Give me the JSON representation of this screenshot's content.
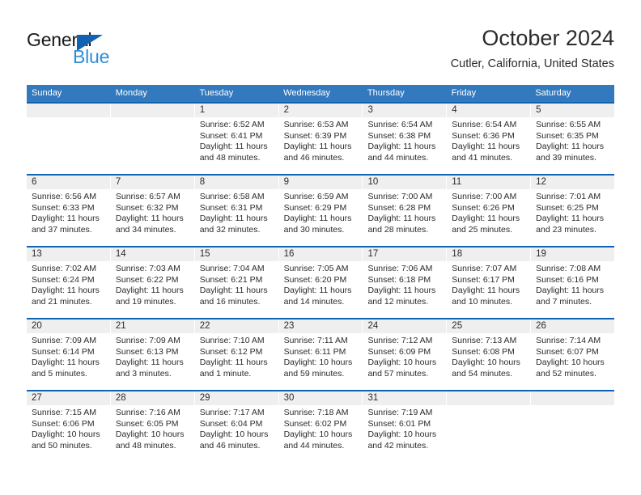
{
  "logo": {
    "word_one": "General",
    "word_two": "Blue",
    "triangle_icon": "triangle-icon",
    "brand_blue": "#2a8fd8",
    "triangle_blue": "#1262b3"
  },
  "header": {
    "title": "October 2024",
    "subtitle": "Cutler, California, United States"
  },
  "colors": {
    "header_row_bg": "#3279bd",
    "week_border": "#1262b3",
    "daynum_bg": "#efefef",
    "text": "#2b2b2b"
  },
  "weekdays": [
    "Sunday",
    "Monday",
    "Tuesday",
    "Wednesday",
    "Thursday",
    "Friday",
    "Saturday"
  ],
  "weeks": [
    [
      {
        "day": "",
        "sunrise": "",
        "sunset": "",
        "daylight_line1": "",
        "daylight_line2": "",
        "empty": true
      },
      {
        "day": "",
        "sunrise": "",
        "sunset": "",
        "daylight_line1": "",
        "daylight_line2": "",
        "empty": true
      },
      {
        "day": "1",
        "sunrise": "Sunrise: 6:52 AM",
        "sunset": "Sunset: 6:41 PM",
        "daylight_line1": "Daylight: 11 hours",
        "daylight_line2": "and 48 minutes.",
        "empty": false
      },
      {
        "day": "2",
        "sunrise": "Sunrise: 6:53 AM",
        "sunset": "Sunset: 6:39 PM",
        "daylight_line1": "Daylight: 11 hours",
        "daylight_line2": "and 46 minutes.",
        "empty": false
      },
      {
        "day": "3",
        "sunrise": "Sunrise: 6:54 AM",
        "sunset": "Sunset: 6:38 PM",
        "daylight_line1": "Daylight: 11 hours",
        "daylight_line2": "and 44 minutes.",
        "empty": false
      },
      {
        "day": "4",
        "sunrise": "Sunrise: 6:54 AM",
        "sunset": "Sunset: 6:36 PM",
        "daylight_line1": "Daylight: 11 hours",
        "daylight_line2": "and 41 minutes.",
        "empty": false
      },
      {
        "day": "5",
        "sunrise": "Sunrise: 6:55 AM",
        "sunset": "Sunset: 6:35 PM",
        "daylight_line1": "Daylight: 11 hours",
        "daylight_line2": "and 39 minutes.",
        "empty": false
      }
    ],
    [
      {
        "day": "6",
        "sunrise": "Sunrise: 6:56 AM",
        "sunset": "Sunset: 6:33 PM",
        "daylight_line1": "Daylight: 11 hours",
        "daylight_line2": "and 37 minutes.",
        "empty": false
      },
      {
        "day": "7",
        "sunrise": "Sunrise: 6:57 AM",
        "sunset": "Sunset: 6:32 PM",
        "daylight_line1": "Daylight: 11 hours",
        "daylight_line2": "and 34 minutes.",
        "empty": false
      },
      {
        "day": "8",
        "sunrise": "Sunrise: 6:58 AM",
        "sunset": "Sunset: 6:31 PM",
        "daylight_line1": "Daylight: 11 hours",
        "daylight_line2": "and 32 minutes.",
        "empty": false
      },
      {
        "day": "9",
        "sunrise": "Sunrise: 6:59 AM",
        "sunset": "Sunset: 6:29 PM",
        "daylight_line1": "Daylight: 11 hours",
        "daylight_line2": "and 30 minutes.",
        "empty": false
      },
      {
        "day": "10",
        "sunrise": "Sunrise: 7:00 AM",
        "sunset": "Sunset: 6:28 PM",
        "daylight_line1": "Daylight: 11 hours",
        "daylight_line2": "and 28 minutes.",
        "empty": false
      },
      {
        "day": "11",
        "sunrise": "Sunrise: 7:00 AM",
        "sunset": "Sunset: 6:26 PM",
        "daylight_line1": "Daylight: 11 hours",
        "daylight_line2": "and 25 minutes.",
        "empty": false
      },
      {
        "day": "12",
        "sunrise": "Sunrise: 7:01 AM",
        "sunset": "Sunset: 6:25 PM",
        "daylight_line1": "Daylight: 11 hours",
        "daylight_line2": "and 23 minutes.",
        "empty": false
      }
    ],
    [
      {
        "day": "13",
        "sunrise": "Sunrise: 7:02 AM",
        "sunset": "Sunset: 6:24 PM",
        "daylight_line1": "Daylight: 11 hours",
        "daylight_line2": "and 21 minutes.",
        "empty": false
      },
      {
        "day": "14",
        "sunrise": "Sunrise: 7:03 AM",
        "sunset": "Sunset: 6:22 PM",
        "daylight_line1": "Daylight: 11 hours",
        "daylight_line2": "and 19 minutes.",
        "empty": false
      },
      {
        "day": "15",
        "sunrise": "Sunrise: 7:04 AM",
        "sunset": "Sunset: 6:21 PM",
        "daylight_line1": "Daylight: 11 hours",
        "daylight_line2": "and 16 minutes.",
        "empty": false
      },
      {
        "day": "16",
        "sunrise": "Sunrise: 7:05 AM",
        "sunset": "Sunset: 6:20 PM",
        "daylight_line1": "Daylight: 11 hours",
        "daylight_line2": "and 14 minutes.",
        "empty": false
      },
      {
        "day": "17",
        "sunrise": "Sunrise: 7:06 AM",
        "sunset": "Sunset: 6:18 PM",
        "daylight_line1": "Daylight: 11 hours",
        "daylight_line2": "and 12 minutes.",
        "empty": false
      },
      {
        "day": "18",
        "sunrise": "Sunrise: 7:07 AM",
        "sunset": "Sunset: 6:17 PM",
        "daylight_line1": "Daylight: 11 hours",
        "daylight_line2": "and 10 minutes.",
        "empty": false
      },
      {
        "day": "19",
        "sunrise": "Sunrise: 7:08 AM",
        "sunset": "Sunset: 6:16 PM",
        "daylight_line1": "Daylight: 11 hours",
        "daylight_line2": "and 7 minutes.",
        "empty": false
      }
    ],
    [
      {
        "day": "20",
        "sunrise": "Sunrise: 7:09 AM",
        "sunset": "Sunset: 6:14 PM",
        "daylight_line1": "Daylight: 11 hours",
        "daylight_line2": "and 5 minutes.",
        "empty": false
      },
      {
        "day": "21",
        "sunrise": "Sunrise: 7:09 AM",
        "sunset": "Sunset: 6:13 PM",
        "daylight_line1": "Daylight: 11 hours",
        "daylight_line2": "and 3 minutes.",
        "empty": false
      },
      {
        "day": "22",
        "sunrise": "Sunrise: 7:10 AM",
        "sunset": "Sunset: 6:12 PM",
        "daylight_line1": "Daylight: 11 hours",
        "daylight_line2": "and 1 minute.",
        "empty": false
      },
      {
        "day": "23",
        "sunrise": "Sunrise: 7:11 AM",
        "sunset": "Sunset: 6:11 PM",
        "daylight_line1": "Daylight: 10 hours",
        "daylight_line2": "and 59 minutes.",
        "empty": false
      },
      {
        "day": "24",
        "sunrise": "Sunrise: 7:12 AM",
        "sunset": "Sunset: 6:09 PM",
        "daylight_line1": "Daylight: 10 hours",
        "daylight_line2": "and 57 minutes.",
        "empty": false
      },
      {
        "day": "25",
        "sunrise": "Sunrise: 7:13 AM",
        "sunset": "Sunset: 6:08 PM",
        "daylight_line1": "Daylight: 10 hours",
        "daylight_line2": "and 54 minutes.",
        "empty": false
      },
      {
        "day": "26",
        "sunrise": "Sunrise: 7:14 AM",
        "sunset": "Sunset: 6:07 PM",
        "daylight_line1": "Daylight: 10 hours",
        "daylight_line2": "and 52 minutes.",
        "empty": false
      }
    ],
    [
      {
        "day": "27",
        "sunrise": "Sunrise: 7:15 AM",
        "sunset": "Sunset: 6:06 PM",
        "daylight_line1": "Daylight: 10 hours",
        "daylight_line2": "and 50 minutes.",
        "empty": false
      },
      {
        "day": "28",
        "sunrise": "Sunrise: 7:16 AM",
        "sunset": "Sunset: 6:05 PM",
        "daylight_line1": "Daylight: 10 hours",
        "daylight_line2": "and 48 minutes.",
        "empty": false
      },
      {
        "day": "29",
        "sunrise": "Sunrise: 7:17 AM",
        "sunset": "Sunset: 6:04 PM",
        "daylight_line1": "Daylight: 10 hours",
        "daylight_line2": "and 46 minutes.",
        "empty": false
      },
      {
        "day": "30",
        "sunrise": "Sunrise: 7:18 AM",
        "sunset": "Sunset: 6:02 PM",
        "daylight_line1": "Daylight: 10 hours",
        "daylight_line2": "and 44 minutes.",
        "empty": false
      },
      {
        "day": "31",
        "sunrise": "Sunrise: 7:19 AM",
        "sunset": "Sunset: 6:01 PM",
        "daylight_line1": "Daylight: 10 hours",
        "daylight_line2": "and 42 minutes.",
        "empty": false
      },
      {
        "day": "",
        "sunrise": "",
        "sunset": "",
        "daylight_line1": "",
        "daylight_line2": "",
        "empty": true
      },
      {
        "day": "",
        "sunrise": "",
        "sunset": "",
        "daylight_line1": "",
        "daylight_line2": "",
        "empty": true
      }
    ]
  ]
}
